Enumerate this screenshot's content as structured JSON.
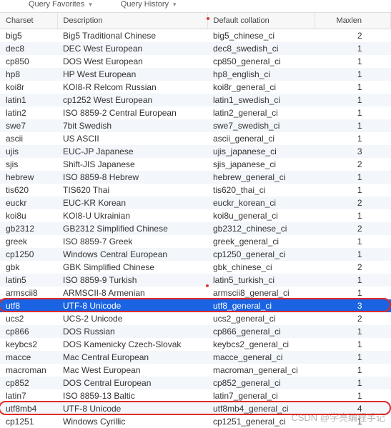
{
  "tabs": {
    "favorites": "Query Favorites",
    "history": "Query History"
  },
  "columns": {
    "charset": "Charset",
    "description": "Description",
    "collation": "Default collation",
    "maxlen": "Maxlen"
  },
  "rows": [
    {
      "c": "big5",
      "d": "Big5 Traditional Chinese",
      "o": "big5_chinese_ci",
      "m": "2"
    },
    {
      "c": "dec8",
      "d": "DEC West European",
      "o": "dec8_swedish_ci",
      "m": "1"
    },
    {
      "c": "cp850",
      "d": "DOS West European",
      "o": "cp850_general_ci",
      "m": "1"
    },
    {
      "c": "hp8",
      "d": "HP West European",
      "o": "hp8_english_ci",
      "m": "1"
    },
    {
      "c": "koi8r",
      "d": "KOI8-R Relcom Russian",
      "o": "koi8r_general_ci",
      "m": "1"
    },
    {
      "c": "latin1",
      "d": "cp1252 West European",
      "o": "latin1_swedish_ci",
      "m": "1"
    },
    {
      "c": "latin2",
      "d": "ISO 8859-2 Central European",
      "o": "latin2_general_ci",
      "m": "1"
    },
    {
      "c": "swe7",
      "d": "7bit Swedish",
      "o": "swe7_swedish_ci",
      "m": "1"
    },
    {
      "c": "ascii",
      "d": "US ASCII",
      "o": "ascii_general_ci",
      "m": "1"
    },
    {
      "c": "ujis",
      "d": "EUC-JP Japanese",
      "o": "ujis_japanese_ci",
      "m": "3"
    },
    {
      "c": "sjis",
      "d": "Shift-JIS Japanese",
      "o": "sjis_japanese_ci",
      "m": "2"
    },
    {
      "c": "hebrew",
      "d": "ISO 8859-8 Hebrew",
      "o": "hebrew_general_ci",
      "m": "1"
    },
    {
      "c": "tis620",
      "d": "TIS620 Thai",
      "o": "tis620_thai_ci",
      "m": "1"
    },
    {
      "c": "euckr",
      "d": "EUC-KR Korean",
      "o": "euckr_korean_ci",
      "m": "2"
    },
    {
      "c": "koi8u",
      "d": "KOI8-U Ukrainian",
      "o": "koi8u_general_ci",
      "m": "1"
    },
    {
      "c": "gb2312",
      "d": "GB2312 Simplified Chinese",
      "o": "gb2312_chinese_ci",
      "m": "2"
    },
    {
      "c": "greek",
      "d": "ISO 8859-7 Greek",
      "o": "greek_general_ci",
      "m": "1"
    },
    {
      "c": "cp1250",
      "d": "Windows Central European",
      "o": "cp1250_general_ci",
      "m": "1"
    },
    {
      "c": "gbk",
      "d": "GBK Simplified Chinese",
      "o": "gbk_chinese_ci",
      "m": "2"
    },
    {
      "c": "latin5",
      "d": "ISO 8859-9 Turkish",
      "o": "latin5_turkish_ci",
      "m": "1"
    },
    {
      "c": "armscii8",
      "d": "ARMSCII-8 Armenian",
      "o": "armscii8_general_ci",
      "m": "1"
    },
    {
      "c": "utf8",
      "d": "UTF-8 Unicode",
      "o": "utf8_general_ci",
      "m": "3",
      "sel": true,
      "hl": true
    },
    {
      "c": "ucs2",
      "d": "UCS-2 Unicode",
      "o": "ucs2_general_ci",
      "m": "2"
    },
    {
      "c": "cp866",
      "d": "DOS Russian",
      "o": "cp866_general_ci",
      "m": "1"
    },
    {
      "c": "keybcs2",
      "d": "DOS Kamenicky Czech-Slovak",
      "o": "keybcs2_general_ci",
      "m": "1"
    },
    {
      "c": "macce",
      "d": "Mac Central European",
      "o": "macce_general_ci",
      "m": "1"
    },
    {
      "c": "macroman",
      "d": "Mac West European",
      "o": "macroman_general_ci",
      "m": "1"
    },
    {
      "c": "cp852",
      "d": "DOS Central European",
      "o": "cp852_general_ci",
      "m": "1"
    },
    {
      "c": "latin7",
      "d": "ISO 8859-13 Baltic",
      "o": "latin7_general_ci",
      "m": "1"
    },
    {
      "c": "utf8mb4",
      "d": "UTF-8 Unicode",
      "o": "utf8mb4_general_ci",
      "m": "4",
      "hl": true
    },
    {
      "c": "cp1251",
      "d": "Windows Cyrillic",
      "o": "cp1251_general_ci",
      "m": "1"
    }
  ],
  "watermark": "CSDN @学亮编程手记"
}
